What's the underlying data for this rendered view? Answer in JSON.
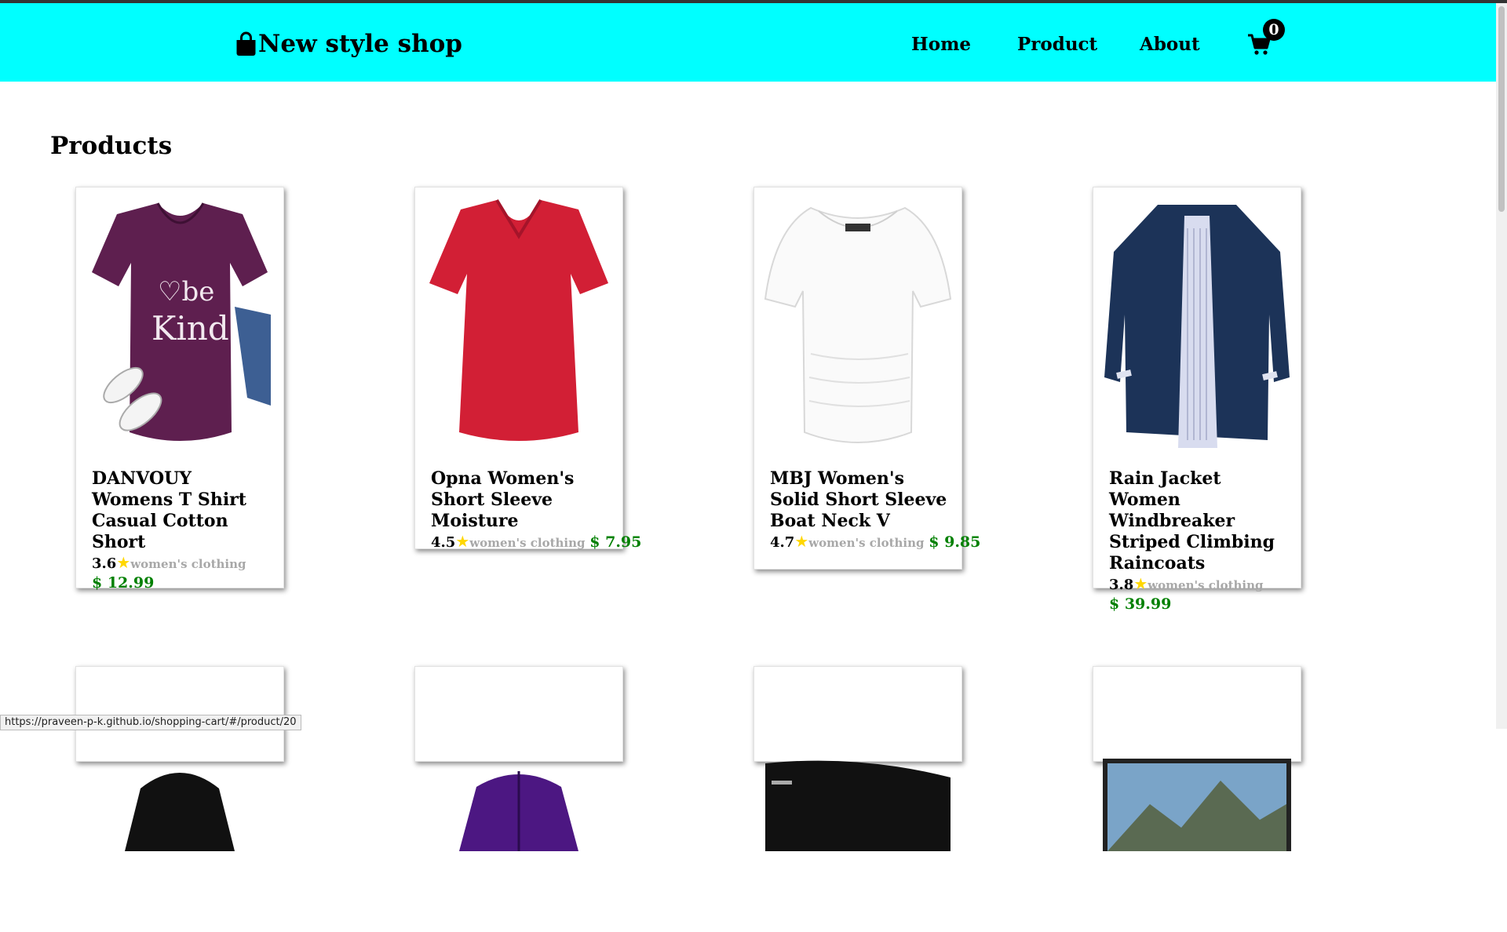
{
  "header": {
    "brand": "New style shop",
    "nav": [
      "Home",
      "Product",
      "About"
    ],
    "cart_count": "0",
    "bg_color": "#00ffff"
  },
  "main": {
    "title": "Products",
    "products": [
      {
        "title": "DANVOUY Womens T Shirt Casual Cotton Short",
        "rating": "3.6",
        "category": "women's clothing",
        "price": "$ 12.99"
      },
      {
        "title": "Opna Women's Short Sleeve Moisture",
        "rating": "4.5",
        "category": "women's clothing",
        "price": "$ 7.95"
      },
      {
        "title": "MBJ Women's Solid Short Sleeve Boat Neck V",
        "rating": "4.7",
        "category": "women's clothing",
        "price": "$ 9.85"
      },
      {
        "title": "Rain Jacket Women Windbreaker Striped Climbing Raincoats",
        "rating": "3.8",
        "category": "women's clothing",
        "price": "$ 39.99"
      }
    ],
    "rating_icon": "star-icon",
    "price_color": "#008000"
  },
  "status_url": "https://praveen-p-k.github.io/shopping-cart/#/product/20"
}
